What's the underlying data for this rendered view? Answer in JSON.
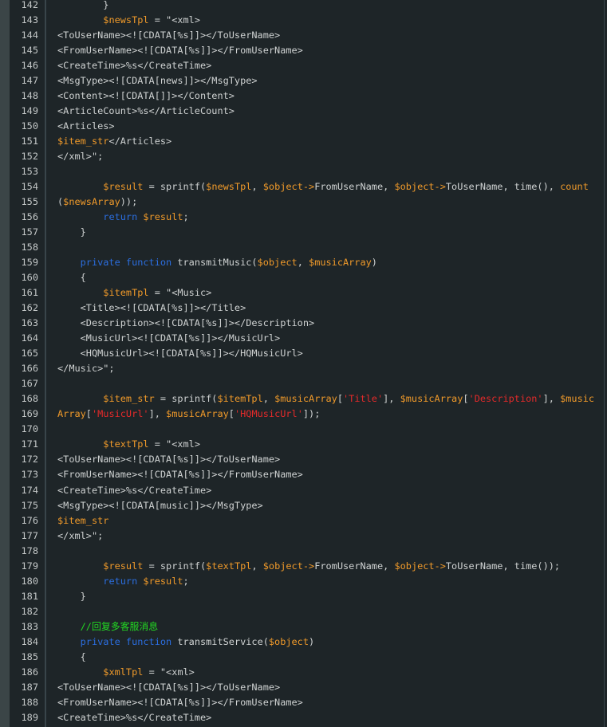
{
  "colors": {
    "background": "#1e2528",
    "variable": "#f09a2a",
    "keyword": "#2b6ee0",
    "string": "#e42a2a",
    "comment": "#22d822",
    "text": "#cfd2d2"
  },
  "lines": [
    {
      "n": "142",
      "t": [
        [
          "t",
          "        }"
        ]
      ]
    },
    {
      "n": "143",
      "t": [
        [
          "t",
          "        "
        ],
        [
          "v",
          "$newsTpl"
        ],
        [
          "t",
          " = \"<xml>"
        ]
      ]
    },
    {
      "n": "144",
      "t": [
        [
          "t",
          "<ToUserName><![CDATA[%s]]></ToUserName>"
        ]
      ]
    },
    {
      "n": "145",
      "t": [
        [
          "t",
          "<FromUserName><![CDATA[%s]]></FromUserName>"
        ]
      ]
    },
    {
      "n": "146",
      "t": [
        [
          "t",
          "<CreateTime>%s</CreateTime>"
        ]
      ]
    },
    {
      "n": "147",
      "t": [
        [
          "t",
          "<MsgType><![CDATA[news]]></MsgType>"
        ]
      ]
    },
    {
      "n": "148",
      "t": [
        [
          "t",
          "<Content><![CDATA[]]></Content>"
        ]
      ]
    },
    {
      "n": "149",
      "t": [
        [
          "t",
          "<ArticleCount>%s</ArticleCount>"
        ]
      ]
    },
    {
      "n": "150",
      "t": [
        [
          "t",
          "<Articles>"
        ]
      ]
    },
    {
      "n": "151",
      "t": [
        [
          "v",
          "$item_str"
        ],
        [
          "t",
          "</Articles>"
        ]
      ]
    },
    {
      "n": "152",
      "t": [
        [
          "t",
          "</xml>\";"
        ]
      ]
    },
    {
      "n": "153",
      "t": []
    },
    {
      "n": "154",
      "t": [
        [
          "t",
          "        "
        ],
        [
          "v",
          "$result"
        ],
        [
          "t",
          " = sprintf("
        ],
        [
          "v",
          "$newsTpl"
        ],
        [
          "t",
          ", "
        ],
        [
          "v",
          "$object->"
        ],
        [
          "t",
          "FromUserName, "
        ],
        [
          "v",
          "$object->"
        ],
        [
          "t",
          "ToUserName, time(), "
        ],
        [
          "v",
          "count"
        ]
      ]
    },
    {
      "n": "155",
      "t": [
        [
          "t",
          "("
        ],
        [
          "v",
          "$newsArray"
        ],
        [
          "t",
          "));"
        ]
      ]
    },
    {
      "n": "156",
      "t": [
        [
          "t",
          "        "
        ],
        [
          "k",
          "return"
        ],
        [
          "t",
          " "
        ],
        [
          "v",
          "$result"
        ],
        [
          "t",
          ";"
        ]
      ]
    },
    {
      "n": "157",
      "t": [
        [
          "t",
          "    }"
        ]
      ]
    },
    {
      "n": "158",
      "t": []
    },
    {
      "n": "159",
      "t": [
        [
          "t",
          "    "
        ],
        [
          "k",
          "private function"
        ],
        [
          "t",
          " transmitMusic("
        ],
        [
          "v",
          "$object"
        ],
        [
          "t",
          ", "
        ],
        [
          "v",
          "$musicArray"
        ],
        [
          "t",
          ")"
        ]
      ]
    },
    {
      "n": "160",
      "t": [
        [
          "t",
          "    {"
        ]
      ]
    },
    {
      "n": "161",
      "t": [
        [
          "t",
          "        "
        ],
        [
          "v",
          "$itemTpl"
        ],
        [
          "t",
          " = \"<Music>"
        ]
      ]
    },
    {
      "n": "162",
      "t": [
        [
          "t",
          "    <Title><![CDATA[%s]]></Title>"
        ]
      ]
    },
    {
      "n": "163",
      "t": [
        [
          "t",
          "    <Description><![CDATA[%s]]></Description>"
        ]
      ]
    },
    {
      "n": "164",
      "t": [
        [
          "t",
          "    <MusicUrl><![CDATA[%s]]></MusicUrl>"
        ]
      ]
    },
    {
      "n": "165",
      "t": [
        [
          "t",
          "    <HQMusicUrl><![CDATA[%s]]></HQMusicUrl>"
        ]
      ]
    },
    {
      "n": "166",
      "t": [
        [
          "t",
          "</Music>\";"
        ]
      ]
    },
    {
      "n": "167",
      "t": []
    },
    {
      "n": "168",
      "t": [
        [
          "t",
          "        "
        ],
        [
          "v",
          "$item_str"
        ],
        [
          "t",
          " = sprintf("
        ],
        [
          "v",
          "$itemTpl"
        ],
        [
          "t",
          ", "
        ],
        [
          "v",
          "$musicArray"
        ],
        [
          "t",
          "["
        ],
        [
          "s",
          "'Title'"
        ],
        [
          "t",
          "], "
        ],
        [
          "v",
          "$musicArray"
        ],
        [
          "t",
          "["
        ],
        [
          "s",
          "'Description'"
        ],
        [
          "t",
          "], "
        ],
        [
          "v",
          "$music"
        ]
      ]
    },
    {
      "n": "169",
      "t": [
        [
          "v",
          "Array"
        ],
        [
          "t",
          "["
        ],
        [
          "s",
          "'MusicUrl'"
        ],
        [
          "t",
          "], "
        ],
        [
          "v",
          "$musicArray"
        ],
        [
          "t",
          "["
        ],
        [
          "s",
          "'HQMusicUrl'"
        ],
        [
          "t",
          "]);"
        ]
      ]
    },
    {
      "n": "170",
      "t": []
    },
    {
      "n": "171",
      "t": [
        [
          "t",
          "        "
        ],
        [
          "v",
          "$textTpl"
        ],
        [
          "t",
          " = \"<xml>"
        ]
      ]
    },
    {
      "n": "172",
      "t": [
        [
          "t",
          "<ToUserName><![CDATA[%s]]></ToUserName>"
        ]
      ]
    },
    {
      "n": "173",
      "t": [
        [
          "t",
          "<FromUserName><![CDATA[%s]]></FromUserName>"
        ]
      ]
    },
    {
      "n": "174",
      "t": [
        [
          "t",
          "<CreateTime>%s</CreateTime>"
        ]
      ]
    },
    {
      "n": "175",
      "t": [
        [
          "t",
          "<MsgType><![CDATA[music]]></MsgType>"
        ]
      ]
    },
    {
      "n": "176",
      "t": [
        [
          "v",
          "$item_str"
        ]
      ]
    },
    {
      "n": "177",
      "t": [
        [
          "t",
          "</xml>\";"
        ]
      ]
    },
    {
      "n": "178",
      "t": []
    },
    {
      "n": "179",
      "t": [
        [
          "t",
          "        "
        ],
        [
          "v",
          "$result"
        ],
        [
          "t",
          " = sprintf("
        ],
        [
          "v",
          "$textTpl"
        ],
        [
          "t",
          ", "
        ],
        [
          "v",
          "$object->"
        ],
        [
          "t",
          "FromUserName, "
        ],
        [
          "v",
          "$object->"
        ],
        [
          "t",
          "ToUserName, time());"
        ]
      ]
    },
    {
      "n": "180",
      "t": [
        [
          "t",
          "        "
        ],
        [
          "k",
          "return"
        ],
        [
          "t",
          " "
        ],
        [
          "v",
          "$result"
        ],
        [
          "t",
          ";"
        ]
      ]
    },
    {
      "n": "181",
      "t": [
        [
          "t",
          "    }"
        ]
      ]
    },
    {
      "n": "182",
      "t": []
    },
    {
      "n": "183",
      "t": [
        [
          "t",
          "    "
        ],
        [
          "c",
          "//回复多客服消息"
        ]
      ]
    },
    {
      "n": "184",
      "t": [
        [
          "t",
          "    "
        ],
        [
          "k",
          "private function"
        ],
        [
          "t",
          " transmitService("
        ],
        [
          "v",
          "$object"
        ],
        [
          "t",
          ")"
        ]
      ]
    },
    {
      "n": "185",
      "t": [
        [
          "t",
          "    {"
        ]
      ]
    },
    {
      "n": "186",
      "t": [
        [
          "t",
          "        "
        ],
        [
          "v",
          "$xmlTpl"
        ],
        [
          "t",
          " = \"<xml>"
        ]
      ]
    },
    {
      "n": "187",
      "t": [
        [
          "t",
          "<ToUserName><![CDATA[%s]]></ToUserName>"
        ]
      ]
    },
    {
      "n": "188",
      "t": [
        [
          "t",
          "<FromUserName><![CDATA[%s]]></FromUserName>"
        ]
      ]
    },
    {
      "n": "189",
      "t": [
        [
          "t",
          "<CreateTime>%s</CreateTime>"
        ]
      ]
    }
  ]
}
